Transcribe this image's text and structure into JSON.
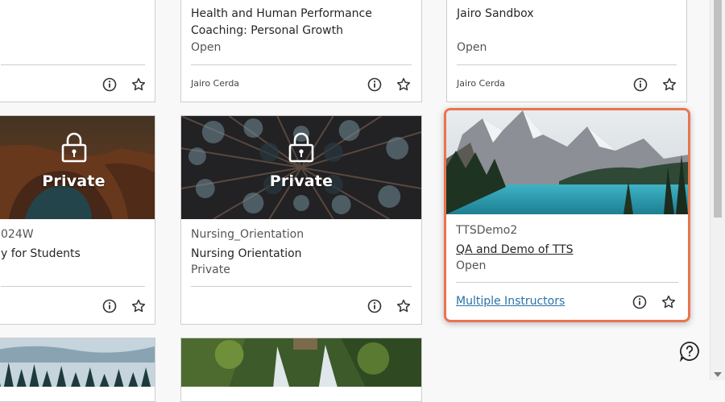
{
  "cards": {
    "top_left": {},
    "top_mid": {
      "title_line1": "Health and Human Performance",
      "title_line2": "Coaching: Personal Growth",
      "status": "Open",
      "instructor": "Jairo Cerda"
    },
    "top_right": {
      "title": "Jairo Sandbox",
      "status": "Open",
      "instructor": "Jairo Cerda"
    },
    "mid_left": {
      "private_label": "Private",
      "code_partial": "024W",
      "title_partial": "y for Students"
    },
    "mid_mid": {
      "private_label": "Private",
      "code": "Nursing_Orientation",
      "title": "Nursing Orientation",
      "status": "Private"
    },
    "mid_right": {
      "code": "TTSDemo2",
      "title": "QA and Demo of TTS",
      "status": "Open",
      "instructor": "Multiple Instructors"
    }
  },
  "colors": {
    "focus_border": "#e9744f",
    "link": "#2a73a8",
    "card_border": "#cdcdcd"
  },
  "icons": [
    "info-icon",
    "star-icon",
    "lock-icon",
    "help-icon"
  ]
}
